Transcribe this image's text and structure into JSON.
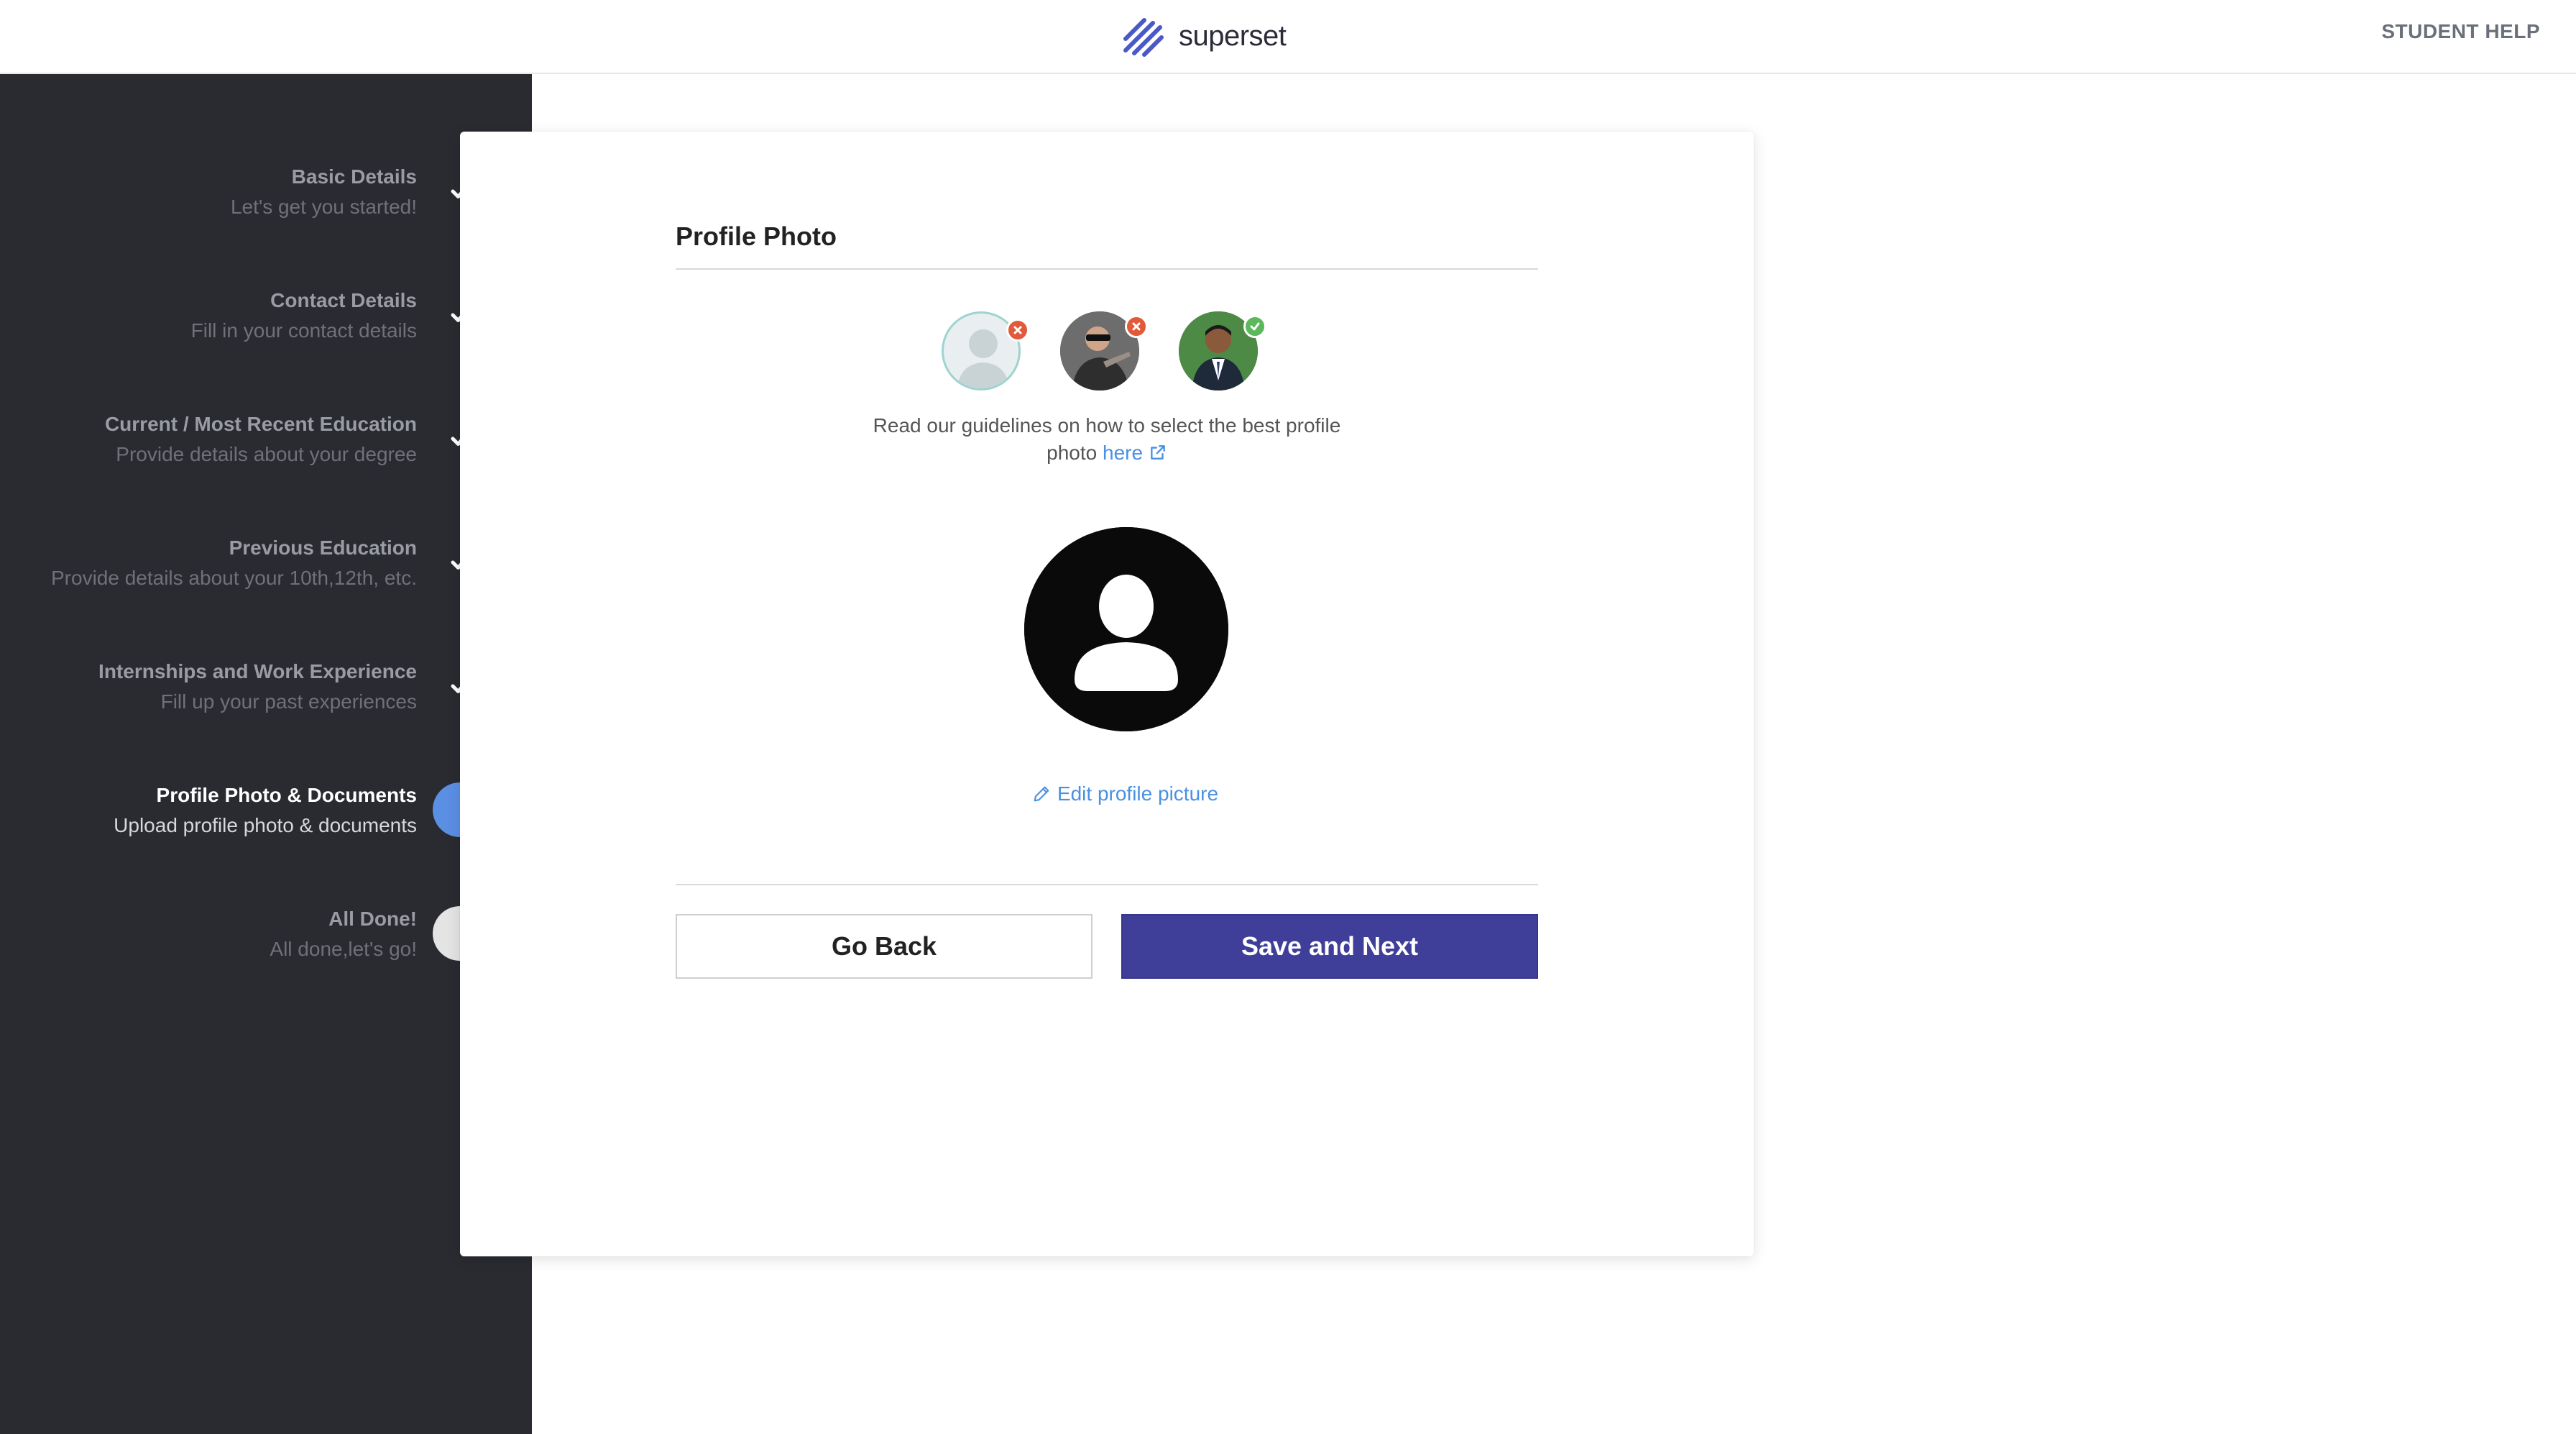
{
  "header": {
    "logo_text": "superset",
    "help_link": "STUDENT HELP"
  },
  "steps": [
    {
      "title": "Basic Details",
      "subtitle": "Let's get you started!",
      "status": "done"
    },
    {
      "title": "Contact Details",
      "subtitle": "Fill in your contact details",
      "status": "done"
    },
    {
      "title": "Current / Most Recent Education",
      "subtitle": "Provide details about your degree",
      "status": "done"
    },
    {
      "title": "Previous Education",
      "subtitle": "Provide details about your 10th,12th, etc.",
      "status": "done"
    },
    {
      "title": "Internships and Work Experience",
      "subtitle": "Fill up your past experiences",
      "status": "done"
    },
    {
      "title": "Profile Photo & Documents",
      "subtitle": "Upload profile photo & documents",
      "status": "current"
    },
    {
      "title": "All Done!",
      "subtitle": "All done,let's go!",
      "status": "todo"
    }
  ],
  "main": {
    "section_title": "Profile Photo",
    "guideline_text": "Read our guidelines on how to select the best profile photo",
    "guideline_link": "here",
    "edit_link": "Edit profile picture"
  },
  "actions": {
    "back_label": "Go Back",
    "next_label": "Save and Next"
  },
  "colors": {
    "sidebar_bg": "#2a2b31",
    "accent_blue": "#5b8fe4",
    "primary_button": "#3f3f9a",
    "link": "#4a90e2",
    "reject_badge": "#e05a3b",
    "accept_badge": "#5cb85c"
  }
}
